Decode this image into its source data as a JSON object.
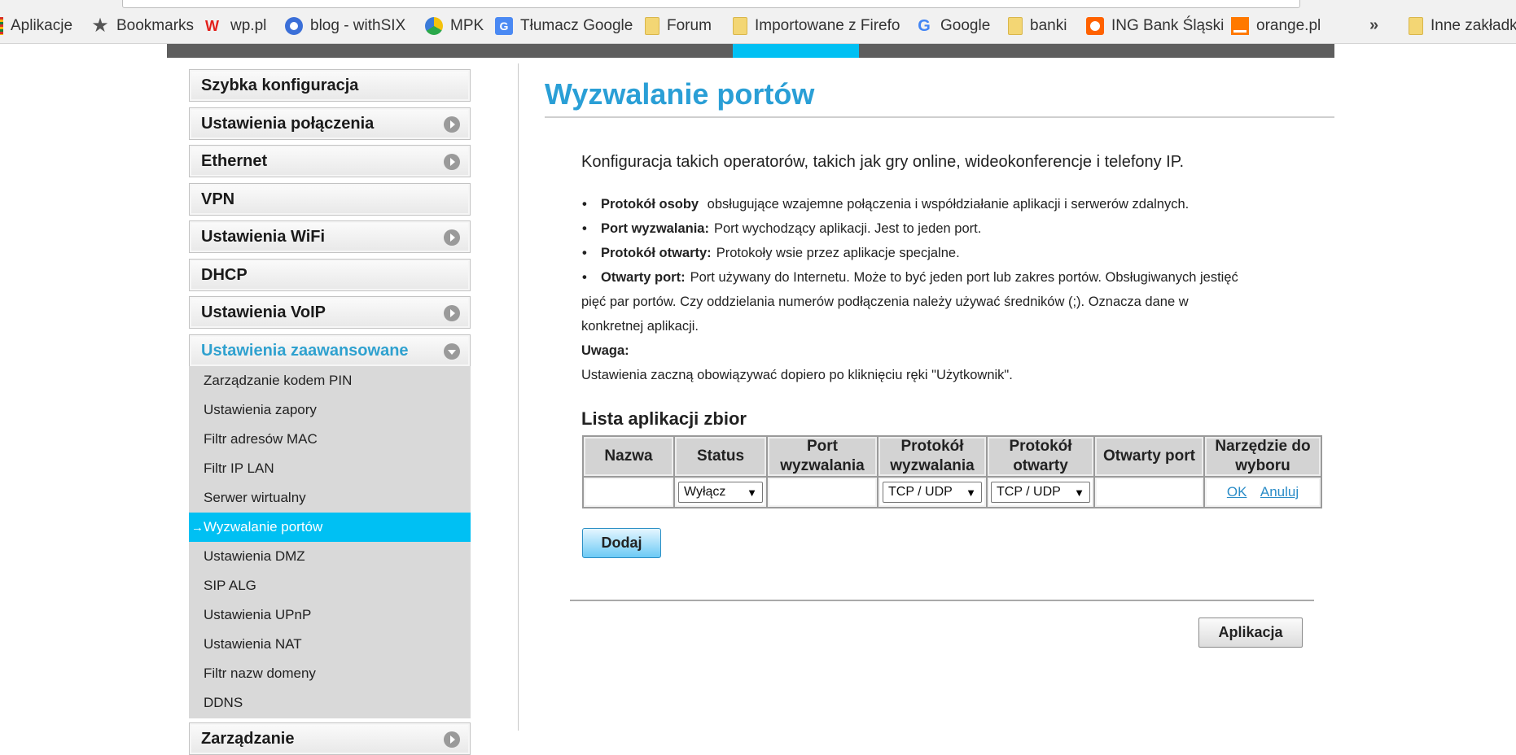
{
  "bookmarks_bar": {
    "items": [
      {
        "label": "Aplikacje",
        "icon": "apps-icon"
      },
      {
        "label": "Bookmarks",
        "icon": "star-icon"
      },
      {
        "label": "wp.pl",
        "icon": "wp-icon"
      },
      {
        "label": "blog - withSIX",
        "icon": "blog-icon"
      },
      {
        "label": "MPK",
        "icon": "mpk-icon"
      },
      {
        "label": "Tłumacz Google",
        "icon": "google-translate-icon"
      },
      {
        "label": "Forum",
        "icon": "folder-icon"
      },
      {
        "label": "Importowane z Firefo",
        "icon": "folder-icon"
      },
      {
        "label": "Google",
        "icon": "google-icon"
      },
      {
        "label": "banki",
        "icon": "folder-icon"
      },
      {
        "label": "ING Bank Śląski",
        "icon": "ing-icon"
      },
      {
        "label": "orange.pl",
        "icon": "orange-icon"
      }
    ],
    "more": "»",
    "other": "Inne zakładk"
  },
  "sidebar": {
    "sections": [
      {
        "label": "Szybka konfiguracja",
        "has_arrow": false
      },
      {
        "label": "Ustawienia połączenia",
        "has_arrow": true
      },
      {
        "label": "Ethernet",
        "has_arrow": true
      },
      {
        "label": "VPN",
        "has_arrow": false
      },
      {
        "label": "Ustawienia WiFi",
        "has_arrow": true
      },
      {
        "label": "DHCP",
        "has_arrow": false
      },
      {
        "label": "Ustawienia VoIP",
        "has_arrow": true
      },
      {
        "label": "Ustawienia zaawansowane",
        "has_arrow": true,
        "expanded": true
      },
      {
        "label": "Zarządzanie",
        "has_arrow": true
      }
    ],
    "sub_items": [
      {
        "label": "Zarządzanie kodem PIN"
      },
      {
        "label": "Ustawienia zapory"
      },
      {
        "label": "Filtr adresów MAC"
      },
      {
        "label": "Filtr IP LAN"
      },
      {
        "label": "Serwer wirtualny"
      },
      {
        "label": "Wyzwalanie portów",
        "active": true,
        "marker": "→"
      },
      {
        "label": "Ustawienia DMZ"
      },
      {
        "label": "SIP ALG"
      },
      {
        "label": "Ustawienia UPnP"
      },
      {
        "label": "Ustawienia NAT"
      },
      {
        "label": "Filtr nazw domeny"
      },
      {
        "label": "DDNS"
      }
    ]
  },
  "main": {
    "title": "Wyzwalanie portów",
    "intro": "Konfiguracja takich operatorów, takich jak gry online, wideokonferencje i telefony IP.",
    "bullets": [
      {
        "term": "Protokół osoby",
        "text": " obsługujące wzajemne połączenia i współdziałanie aplikacji i serwerów zdalnych."
      },
      {
        "term": "Port wyzwalania:",
        "text": "Port wychodzący aplikacji. Jest to jeden port."
      },
      {
        "term": "Protokół otwarty:",
        "text": "Protokoły wsie przez aplikacje specjalne."
      },
      {
        "term": "Otwarty port:",
        "text": "Port używany do Internetu. Może to być jeden port lub zakres portów. Obsługiwanych jestięć"
      }
    ],
    "bullet_continuation": [
      "pięć par portów. Czy oddzielania numerów podłączenia należy używać średników (;). Oznacza dane w",
      "konkretnej aplikacji."
    ],
    "note_label": "Uwaga:",
    "note_text": "Ustawienia zaczną obowiązywać dopiero po kliknięciu ręki \"Użytkownik\".",
    "list_title": "Lista aplikacji zbior",
    "table": {
      "headers": [
        "Nazwa",
        "Status",
        "Port wyzwalania",
        "Protokół wyzwalania",
        "Protokół otwarty",
        "Otwarty port",
        "Narzędzie do wyboru"
      ],
      "row": {
        "name": "",
        "status": "Wyłącz",
        "trigger_port": "",
        "trigger_protocol": "TCP / UDP",
        "open_protocol": "TCP / UDP",
        "open_port": "",
        "ok": "OK",
        "cancel": "Anuluj"
      },
      "select_arrow": "▼"
    },
    "add_button": "Dodaj",
    "apply_button": "Aplikacja"
  }
}
